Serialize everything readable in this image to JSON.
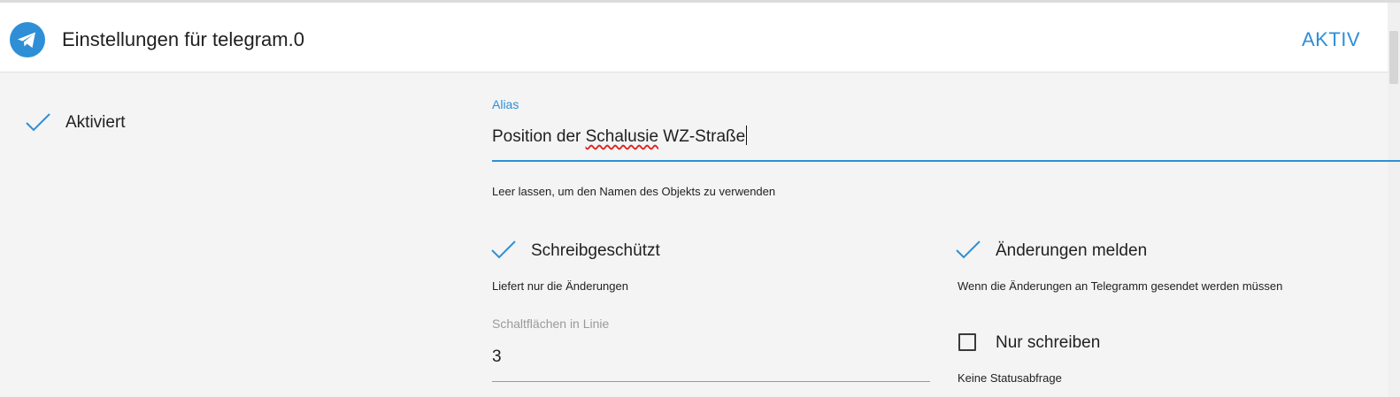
{
  "header": {
    "title": "Einstellungen für telegram.0",
    "action_label": "AKTIV"
  },
  "icons": {
    "app": "telegram-icon",
    "check": "check-icon",
    "checkbox": "checkbox-unchecked-icon"
  },
  "colors": {
    "accent": "#2e8fd6",
    "telegram_blue": "#2e8fd6",
    "background": "#f4f4f4",
    "header_bg": "#ffffff"
  },
  "enabled": {
    "label": "Aktiviert",
    "checked": true
  },
  "alias": {
    "label": "Alias",
    "value_prefix": "Position der ",
    "value_misspelled": "Schalusie",
    "value_suffix": " WZ-Straße",
    "helper": "Leer lassen, um den Namen des Objekts zu verwenden"
  },
  "readonly": {
    "label": "Schreibgeschützt",
    "checked": true,
    "helper": "Liefert nur die Änderungen"
  },
  "report_changes": {
    "label": "Änderungen melden",
    "checked": true,
    "helper": "Wenn die Änderungen an Telegramm gesendet werden müssen"
  },
  "buttons_per_line": {
    "label": "Schaltflächen in Linie",
    "value": "3"
  },
  "write_only": {
    "label": "Nur schreiben",
    "checked": false,
    "helper": "Keine Statusabfrage"
  }
}
